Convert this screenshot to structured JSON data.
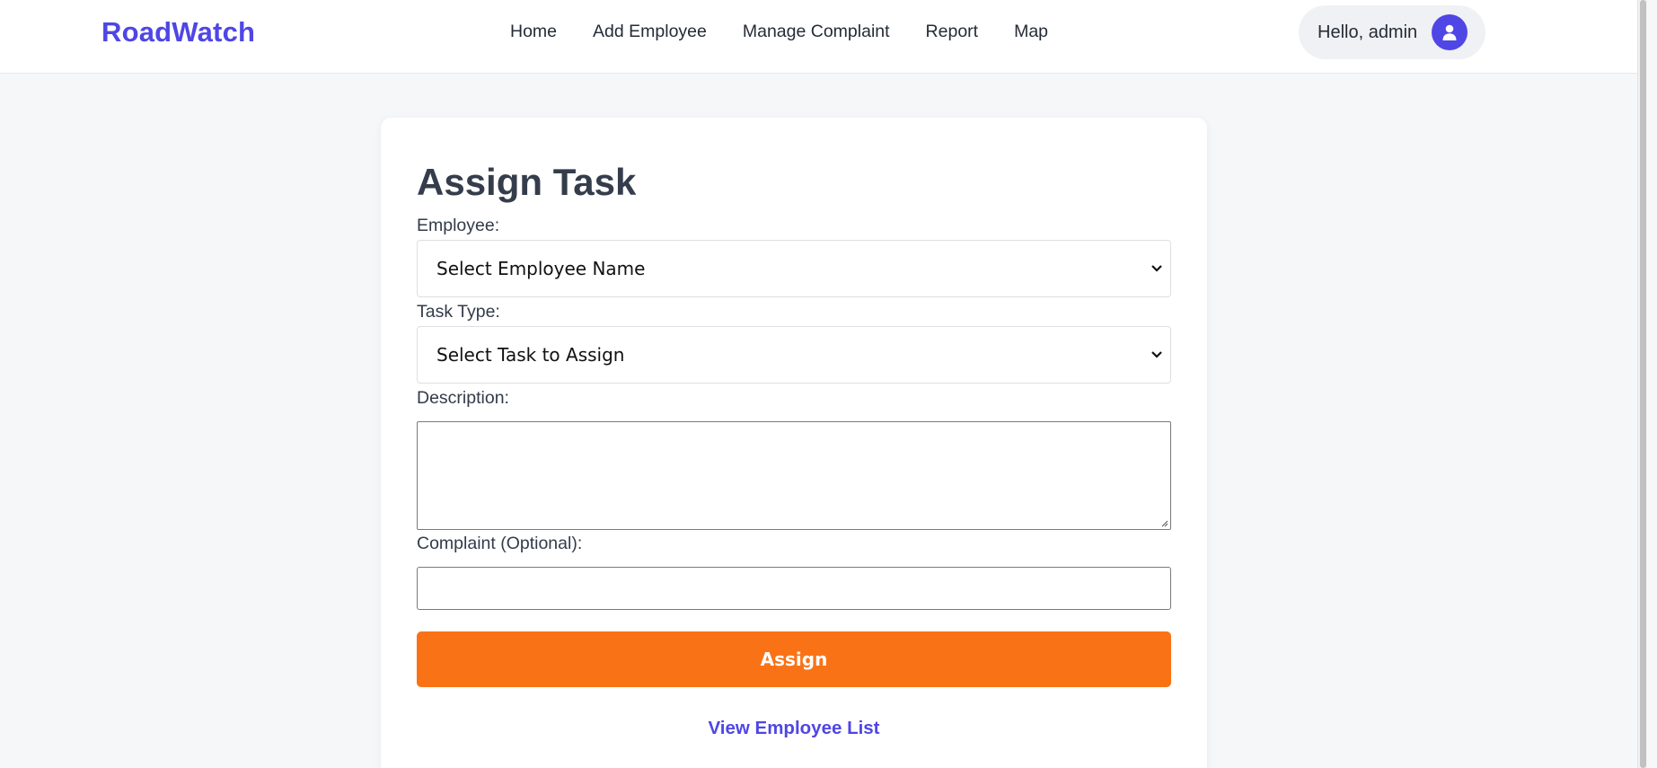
{
  "navbar": {
    "brand": "RoadWatch",
    "links": [
      {
        "label": "Home"
      },
      {
        "label": "Add Employee"
      },
      {
        "label": "Manage Complaint"
      },
      {
        "label": "Report"
      },
      {
        "label": "Map"
      }
    ],
    "greeting": "Hello, admin",
    "avatar_icon": "user-icon"
  },
  "form": {
    "title": "Assign Task",
    "employee": {
      "label": "Employee:",
      "selected": "Select Employee Name"
    },
    "task_type": {
      "label": "Task Type:",
      "selected": "Select Task to Assign"
    },
    "description": {
      "label": "Description:",
      "value": ""
    },
    "complaint": {
      "label": "Complaint (Optional):",
      "value": ""
    },
    "submit_label": "Assign",
    "employee_list_link": "View Employee List"
  },
  "colors": {
    "brand": "#4f46e5",
    "primary_button": "#f97316",
    "background": "#f6f7f9"
  }
}
